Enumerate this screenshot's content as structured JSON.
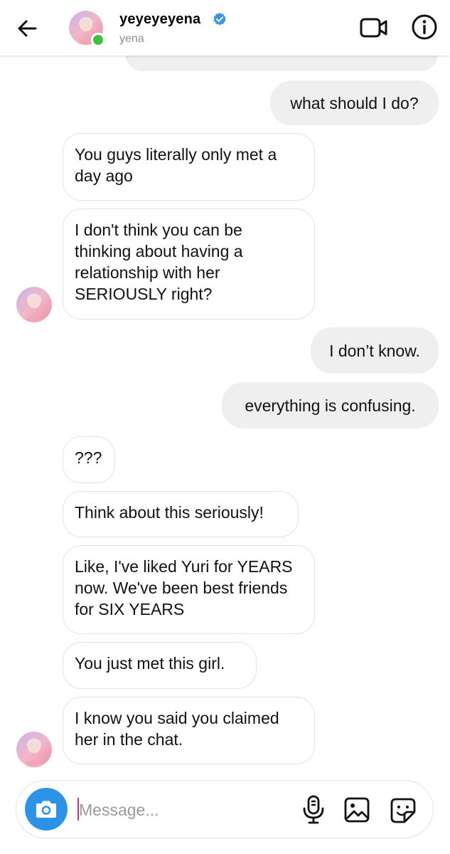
{
  "header": {
    "back_icon": "arrow-left-icon",
    "username": "yeyeyeyena",
    "verified_icon": "verified-badge-icon",
    "subname": "yena",
    "online_color": "#3ec13c",
    "video_icon": "video-camera-icon",
    "info_icon": "info-icon"
  },
  "messages": {
    "m1": "what should I do?",
    "m2": "You guys literally only met a day ago",
    "m3": "I don't think you can be thinking about having a relationship with her SERIOUSLY right?",
    "m4": "I don’t know.",
    "m5": "everything is confusing.",
    "m6": "???",
    "m7": "Think about this seriously!",
    "m8": "Like, I've liked Yuri for YEARS now. We've been best friends for SIX YEARS",
    "m9": "You just met this girl.",
    "m10": "I know you said you claimed her in the chat."
  },
  "composer": {
    "placeholder": "Message...",
    "camera_icon": "camera-icon",
    "mic_icon": "microphone-icon",
    "gallery_icon": "image-icon",
    "sticker_icon": "sticker-icon",
    "accent_color": "#2d93e6"
  }
}
